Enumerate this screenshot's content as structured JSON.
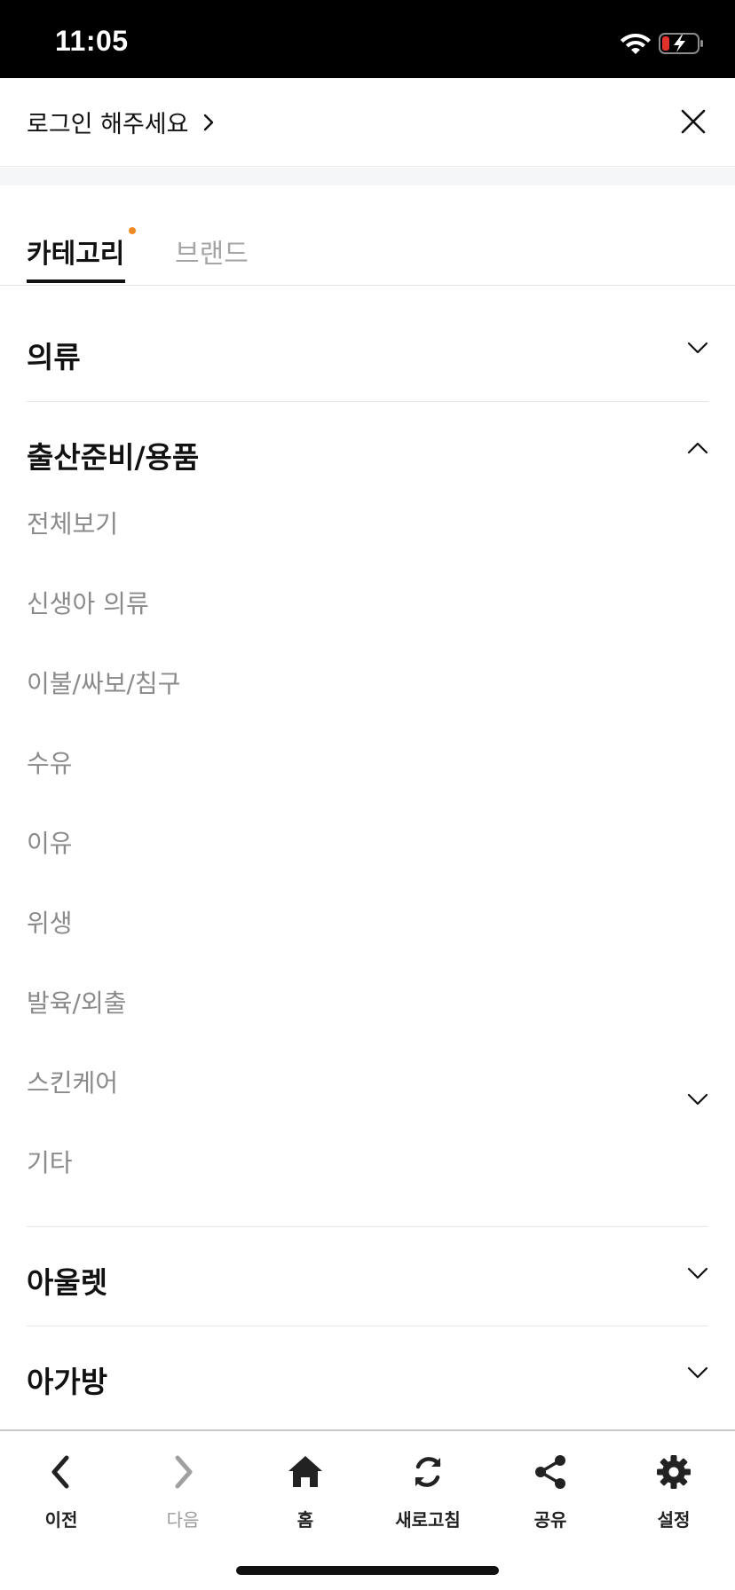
{
  "status_bar": {
    "time": "11:05"
  },
  "header": {
    "login_label": "로그인 해주세요"
  },
  "tabs": [
    {
      "label": "카테고리",
      "active": true
    },
    {
      "label": "브랜드",
      "active": false
    }
  ],
  "categories": [
    {
      "title": "의류",
      "expanded": false
    },
    {
      "title": "출산준비/용품",
      "expanded": true,
      "items": [
        "전체보기",
        "신생아 의류",
        "이불/싸보/침구",
        "수유",
        "이유",
        "위생",
        "발육/외출",
        "스킨케어",
        "기타"
      ]
    },
    {
      "title": "아울렛",
      "expanded": false
    },
    {
      "title": "아가방",
      "expanded": false
    }
  ],
  "toolbar": {
    "back": "이전",
    "next": "다음",
    "home": "홈",
    "refresh": "새로고침",
    "share": "공유",
    "settings": "설정"
  },
  "colors": {
    "accent_dot": "#f08a24",
    "battery_low": "#e0322b"
  }
}
